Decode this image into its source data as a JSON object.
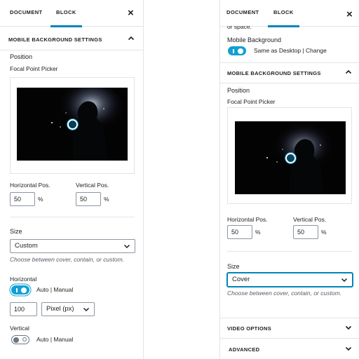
{
  "tabs": {
    "document": "DOCUMENT",
    "block": "BLOCK"
  },
  "close_symbol": "×",
  "left": {
    "section_title": "MOBILE BACKGROUND SETTINGS",
    "position_label": "Position",
    "focal_label": "Focal Point Picker",
    "focal_point": {
      "x_pct": 50,
      "y_pct": 50
    },
    "horizontal_pos_label": "Horizontal Pos.",
    "vertical_pos_label": "Vertical Pos.",
    "horizontal_value": "50",
    "vertical_value": "50",
    "percent": "%",
    "size_label": "Size",
    "size_value": "Custom",
    "size_help": "Choose between cover, contain, or custom.",
    "horizontal_label": "Horizontal",
    "horizontal_toggle_text": "Auto | Manual",
    "horizontal_toggle_on": true,
    "width_value": "100",
    "unit_value": "Pixel (px)",
    "vertical_label": "Vertical",
    "vertical_toggle_text": "Auto | Manual",
    "vertical_toggle_on": false
  },
  "right": {
    "cut_text": "or space.",
    "mobile_bg_label": "Mobile Background",
    "mobile_bg_toggle_text": "Same as Desktop | Change",
    "mobile_bg_toggle_on": true,
    "section_title": "MOBILE BACKGROUND SETTINGS",
    "position_label": "Position",
    "focal_label": "Focal Point Picker",
    "focal_point": {
      "x_pct": 50,
      "y_pct": 50
    },
    "horizontal_pos_label": "Horizontal Pos.",
    "vertical_pos_label": "Vertical Pos.",
    "horizontal_value": "50",
    "vertical_value": "50",
    "percent": "%",
    "size_label": "Size",
    "size_value": "Cover",
    "size_help": "Choose between cover, contain, or custom.",
    "video_options": "VIDEO OPTIONS",
    "advanced": "ADVANCED"
  },
  "icons": {
    "chevron_up": "chevron-up-icon",
    "chevron_down": "chevron-down-icon",
    "close": "close-icon"
  },
  "colors": {
    "accent": "#0085ba",
    "toggle_on": "#11a0d2",
    "border": "#e2e4e7",
    "help_text": "#555d66"
  }
}
